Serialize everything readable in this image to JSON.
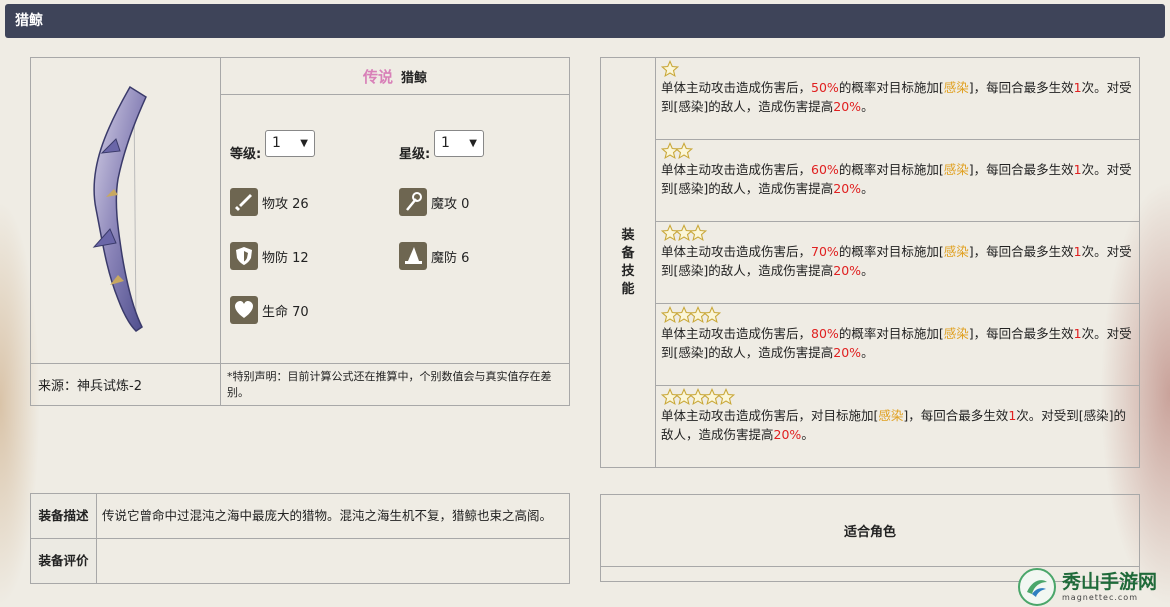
{
  "title": "猎鲸",
  "equipment": {
    "rarity": "传说",
    "name": "猎鲸",
    "level_label": "等级:",
    "level_value": "1",
    "star_label": "星级:",
    "star_value": "1",
    "stats": {
      "patk": "物攻 26",
      "matk": "魔攻 0",
      "pdef": "物防 12",
      "mdef": "魔防 6",
      "hp": "生命 70"
    },
    "source": "来源：神兵试炼-2",
    "note": "*特别声明：目前计算公式还在推算中，个别数值会与真实值存在差别。"
  },
  "skills": {
    "header": [
      "装",
      "备",
      "技",
      "能"
    ],
    "tiers": [
      {
        "stars": 1,
        "p1": "单体主动攻击造成伤害后，",
        "chance": "50%",
        "p2": "的概率对目标施加[",
        "status": "感染",
        "p3": "]，每回合最多生效",
        "times": "1",
        "p4": "次。对受到[感染]的敌人，造成伤害提高",
        "bonus": "20%",
        "p5": "。"
      },
      {
        "stars": 2,
        "p1": "单体主动攻击造成伤害后，",
        "chance": "60%",
        "p2": "的概率对目标施加[",
        "status": "感染",
        "p3": "]，每回合最多生效",
        "times": "1",
        "p4": "次。对受到[感染]的敌人，造成伤害提高",
        "bonus": "20%",
        "p5": "。"
      },
      {
        "stars": 3,
        "p1": "单体主动攻击造成伤害后，",
        "chance": "70%",
        "p2": "的概率对目标施加[",
        "status": "感染",
        "p3": "]，每回合最多生效",
        "times": "1",
        "p4": "次。对受到[感染]的敌人，造成伤害提高",
        "bonus": "20%",
        "p5": "。"
      },
      {
        "stars": 4,
        "p1": "单体主动攻击造成伤害后，",
        "chance": "80%",
        "p2": "的概率对目标施加[",
        "status": "感染",
        "p3": "]，每回合最多生效",
        "times": "1",
        "p4": "次。对受到[感染]的敌人，造成伤害提高",
        "bonus": "20%",
        "p5": "。"
      },
      {
        "stars": 5,
        "p1": "单体主动攻击造成伤害后，",
        "chance": "",
        "p2": "对目标施加[",
        "status": "感染",
        "p3": "]，每回合最多生效",
        "times": "1",
        "p4": "次。对受到[感染]的敌人，造成伤害提高",
        "bonus": "20%",
        "p5": "。"
      }
    ]
  },
  "description": {
    "desc_label": "装备描述",
    "desc_text": "传说它曾命中过混沌之海中最庞大的猎物。混沌之海生机不复，猎鲸也束之高阁。",
    "eval_label": "装备评价",
    "eval_text": ""
  },
  "role": {
    "label": "适合角色"
  },
  "watermark": {
    "main": "秀山手游网",
    "sub": "magnettec.com"
  },
  "colors": {
    "titlebar": "#3e4459",
    "rarity": "#d880b8",
    "highlight_red": "#e02020",
    "highlight_gold": "#e0a020"
  }
}
